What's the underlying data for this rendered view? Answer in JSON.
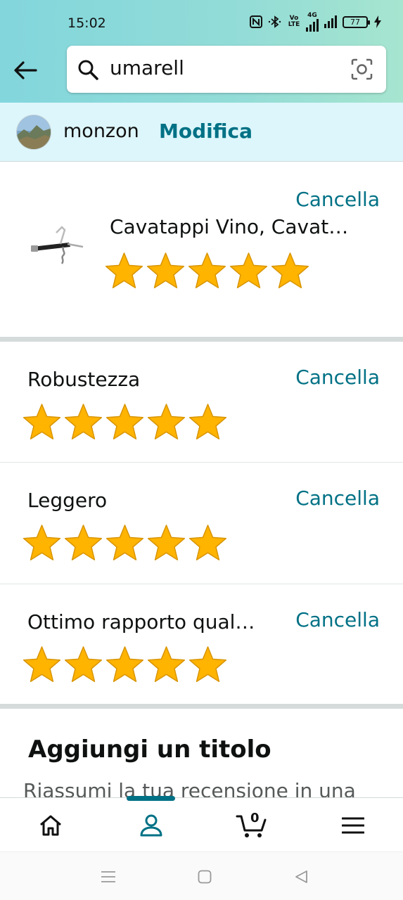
{
  "status_bar": {
    "time": "15:02",
    "battery": "77",
    "icons": [
      "nfc-icon",
      "bluetooth-icon",
      "volte-icon",
      "4g-icon",
      "signal-icon",
      "signal-icon",
      "battery-icon",
      "charging-icon"
    ],
    "volte_label": "Vo LTE",
    "network_label": "4G"
  },
  "search": {
    "query": "umarell"
  },
  "profile": {
    "name": "monzon",
    "edit_label": "Modifica"
  },
  "product": {
    "title": "Cavatappi Vino, Cavat…",
    "rating": 5,
    "cancel_label": "Cancella"
  },
  "attributes": [
    {
      "label": "Robustezza",
      "rating": 5,
      "cancel_label": "Cancella"
    },
    {
      "label": "Leggero",
      "rating": 5,
      "cancel_label": "Cancella"
    },
    {
      "label": "Ottimo rapporto qual…",
      "rating": 5,
      "cancel_label": "Cancella"
    }
  ],
  "title_section": {
    "heading": "Aggiungi un titolo",
    "hint": "Riassumi la tua recensione in una"
  },
  "bottom_nav": {
    "items": [
      "home-icon",
      "account-icon",
      "cart-icon",
      "menu-icon"
    ],
    "active": "account-icon",
    "cart_count": "0"
  },
  "colors": {
    "accent": "#007185",
    "star": "#ffa41c",
    "header_gradient_start": "#82d6dc",
    "profile_bar": "#ddf6fb"
  }
}
